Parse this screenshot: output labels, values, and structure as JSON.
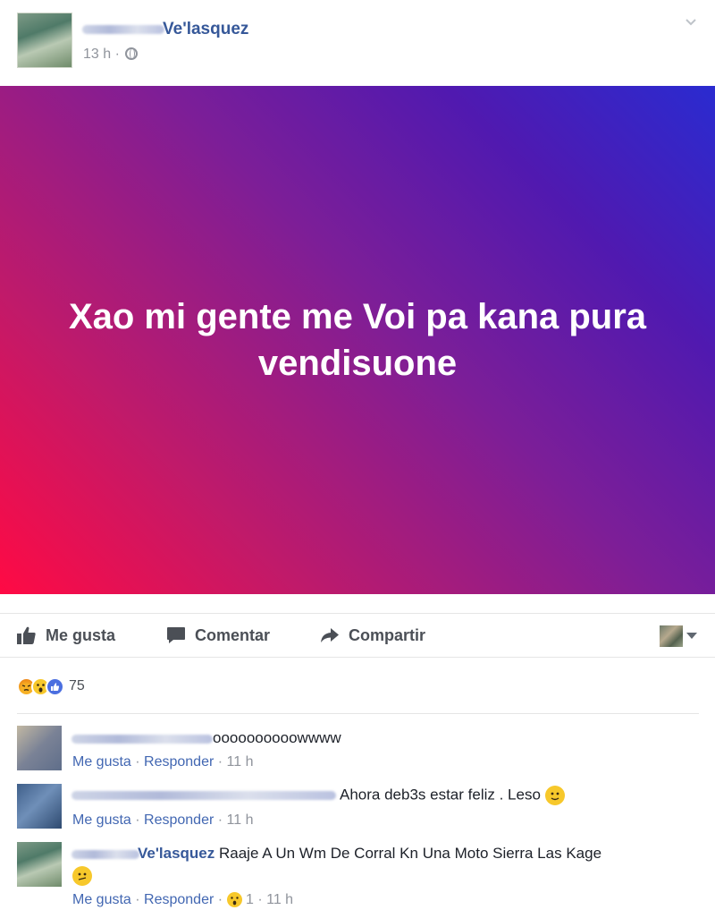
{
  "post": {
    "author_suffix": "Ve'lasquez",
    "time": "13 h",
    "separator": "·",
    "text": "Xao mi gente me Voi pa kana pura vendisuone",
    "gradient": [
      "#ff0a44",
      "#7c1e98",
      "#2a2bd0"
    ]
  },
  "actions": {
    "like": "Me gusta",
    "comment": "Comentar",
    "share": "Compartir"
  },
  "reactions": {
    "icons": [
      "angry-icon",
      "wow-icon",
      "like-icon"
    ],
    "count": "75"
  },
  "comments": [
    {
      "text": "oooooooooowwww",
      "like": "Me gusta",
      "reply": "Responder",
      "time": "11 h"
    },
    {
      "text": "Ahora deb3s estar feliz . Leso",
      "like": "Me gusta",
      "reply": "Responder",
      "time": "11 h"
    },
    {
      "name_suffix": "Ve'lasquez",
      "text": "Raaje A Un Wm De Corral Kn Una Moto Sierra Las Kage",
      "like": "Me gusta",
      "reply": "Responder",
      "reaction_count": "1",
      "time": "11 h"
    }
  ],
  "colors": {
    "link": "#365899",
    "meta": "#90949c",
    "action": "#4b4f56"
  }
}
